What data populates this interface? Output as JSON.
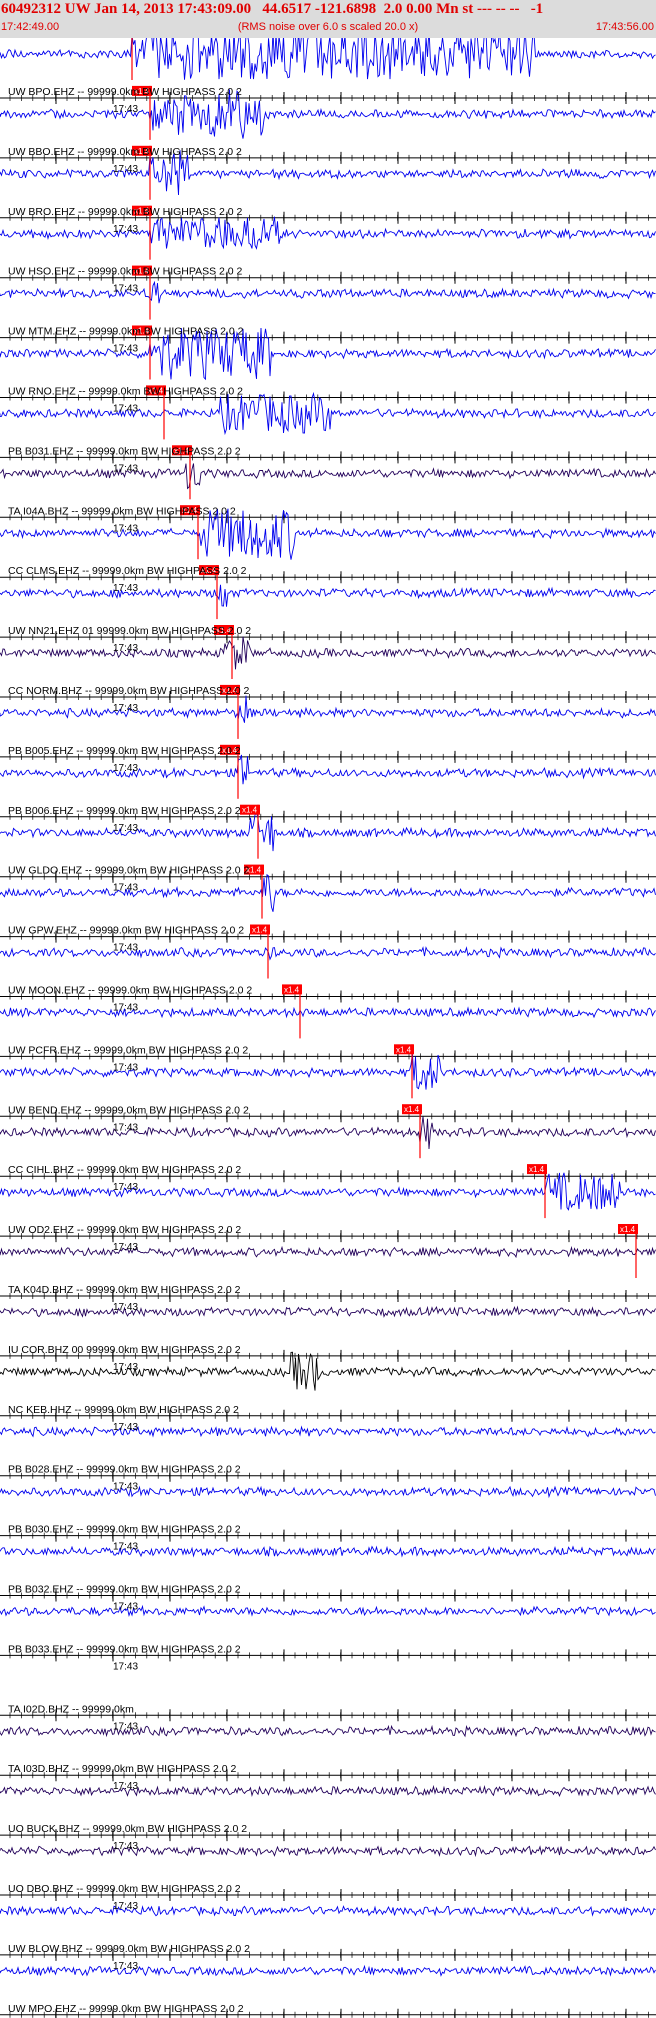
{
  "header": {
    "title": "60492312 UW Jan 14, 2013 17:43:09.00   44.6517 -121.6898  2.0 0.00 Mn st --- -- --   -1",
    "start_time": "17:42:49.00",
    "note": "(RMS noise over 6.0 s scaled 20.0 x)",
    "end_time": "17:43:56.00"
  },
  "colors": {
    "trace_blue": "#0000ee",
    "trace_dark": "#22005a",
    "trace_black": "#000000",
    "pick_red": "#ff0000",
    "tick_label": "#000000"
  },
  "chart_data": {
    "type": "line",
    "time_window": [
      "17:42:49.00",
      "17:43:56.00"
    ],
    "tick_label": "17:43",
    "pick_label": "x1.4",
    "pick_count": 21,
    "traces": [
      {
        "label": "UW BPO.EHZ -- 99999.0km BW  HIGHPASS  2.0  2",
        "color": "blue",
        "pick": true
      },
      {
        "label": "UW BBO.EHZ -- 99999.0km BW  HIGHPASS  2.0  2",
        "color": "blue",
        "pick": true
      },
      {
        "label": "UW BRO.EHZ -- 99999.0km BW  HIGHPASS  2.0  2",
        "color": "blue",
        "pick": true
      },
      {
        "label": "UW HSO.EHZ -- 99999.0km BW  HIGHPASS  2.0  2",
        "color": "blue",
        "pick": true
      },
      {
        "label": "UW MTM.EHZ -- 99999.0km BW  HIGHPASS  2.0  2",
        "color": "blue",
        "pick": true
      },
      {
        "label": "UW RNO.EHZ -- 99999.0km BW  HIGHPASS  2.0  2",
        "color": "blue",
        "pick": true
      },
      {
        "label": "PB B031.EHZ -- 99999.0km BW  HIGHPASS  2.0  2",
        "color": "blue",
        "pick": true
      },
      {
        "label": "TA I04A.BHZ -- 99999.0km BW  HIGHPASS  2.0  2",
        "color": "dark",
        "pick": true
      },
      {
        "label": "CC CLMS.EHZ -- 99999.0km BW  HIGHPASS  2.0  2",
        "color": "blue",
        "pick": true
      },
      {
        "label": "UW NN21.EHZ 01 99999.0km BW  HIGHPASS  2.0  2",
        "color": "blue",
        "pick": true
      },
      {
        "label": "CC NORM.BHZ -- 99999.0km BW  HIGHPASS  2.0  2",
        "color": "dark",
        "pick": true
      },
      {
        "label": "PB B005.EHZ -- 99999.0km BW  HIGHPASS  2.0  2",
        "color": "blue",
        "pick": true
      },
      {
        "label": "PB B006.EHZ -- 99999.0km BW  HIGHPASS  2.0  2",
        "color": "blue",
        "pick": true
      },
      {
        "label": "UW GLDO.EHZ -- 99999.0km BW  HIGHPASS  2.0  2",
        "color": "blue",
        "pick": true
      },
      {
        "label": "UW GPW.EHZ -- 99999.0km BW  HIGHPASS  2.0  2",
        "color": "blue",
        "pick": true
      },
      {
        "label": "UW MOON.EHZ -- 99999.0km BW  HIGHPASS  2.0  2",
        "color": "blue",
        "pick": true
      },
      {
        "label": "UW PCFR.EHZ -- 99999.0km BW  HIGHPASS  2.0  2",
        "color": "blue",
        "pick": true
      },
      {
        "label": "UW BEND.EHZ -- 99999.0km BW  HIGHPASS  2.0  2",
        "color": "blue",
        "pick": true
      },
      {
        "label": "CC CIHL.BHZ -- 99999.0km BW  HIGHPASS  2.0  2",
        "color": "dark",
        "pick": true
      },
      {
        "label": "UW OD2.EHZ -- 99999.0km BW  HIGHPASS  2.0  2",
        "color": "blue",
        "pick": true
      },
      {
        "label": "TA K04D.BHZ -- 99999.0km BW  HIGHPASS  2.0  2",
        "color": "dark",
        "pick": true
      },
      {
        "label": "IU COR.BHZ 00 99999.0km BW  HIGHPASS  2.0  2",
        "color": "dark",
        "pick": false
      },
      {
        "label": "NC KEB.HHZ -- 99999.0km BW  HIGHPASS  2.0  2",
        "color": "black",
        "pick": false
      },
      {
        "label": "PB B028.EHZ -- 99999.0km BW  HIGHPASS  2.0  2",
        "color": "blue",
        "pick": false
      },
      {
        "label": "PB B030.EHZ -- 99999.0km BW  HIGHPASS  2.0  2",
        "color": "blue",
        "pick": false
      },
      {
        "label": "PB B032.EHZ -- 99999.0km BW  HIGHPASS  2.0  2",
        "color": "blue",
        "pick": false
      },
      {
        "label": "PB B033.EHZ -- 99999.0km BW  HIGHPASS  2.0  2",
        "color": "blue",
        "pick": false
      },
      {
        "label": "TA I02D.BHZ -- 99999.0km",
        "color": "none",
        "pick": false
      },
      {
        "label": "TA I03D.BHZ -- 99999.0km BW  HIGHPASS  2.0  2",
        "color": "dark",
        "pick": false
      },
      {
        "label": "UO BUCK.BHZ -- 99999.0km BW  HIGHPASS  2.0  2",
        "color": "dark",
        "pick": false
      },
      {
        "label": "UO DBO.BHZ -- 99999.0km BW  HIGHPASS  2.0  2",
        "color": "dark",
        "pick": false
      },
      {
        "label": "UW BLOW.BHZ -- 99999.0km BW  HIGHPASS  2.0  2",
        "color": "blue",
        "pick": false
      },
      {
        "label": "UW MPO.EHZ -- 99999.0km BW  HIGHPASS  2.0  2",
        "color": "blue",
        "pick": false
      }
    ]
  }
}
